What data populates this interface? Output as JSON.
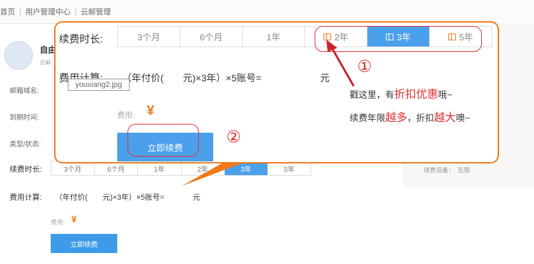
{
  "breadcrumb": [
    "首页",
    "用户管理中心",
    "云邮管理"
  ],
  "background": {
    "account_name": "自由",
    "account_sub": "企邮",
    "labels": [
      "邮箱域名:",
      "到期时间:",
      "类型/状态:"
    ],
    "renew_label": "续费时长:",
    "options": [
      "3个月",
      "6个月",
      "1年",
      "2年",
      "3年",
      "5年"
    ],
    "selected_option": "3年",
    "price_label": "费用计算:",
    "price_formula": "（年付价(　　元)×3年）×5账号=",
    "price_unit": "元",
    "fee_label": "费用:",
    "currency": "¥",
    "submit": "立即续费",
    "right_panel_text": "续费设备：　无限"
  },
  "callout": {
    "renew_label": "续费时长:",
    "options": [
      {
        "label": "3个月",
        "gift": false
      },
      {
        "label": "6个月",
        "gift": false
      },
      {
        "label": "1年",
        "gift": false
      },
      {
        "label": "2年",
        "gift": true
      },
      {
        "label": "3年",
        "gift": true
      },
      {
        "label": "5年",
        "gift": true
      }
    ],
    "selected_option": "3年",
    "price_label": "费用计算:",
    "price_formula": "（年付价(　　元)×3年）×5账号=",
    "price_unit": "元",
    "tooltip": "youxiang2.jpg",
    "fee_label": "费用:",
    "currency": "¥",
    "submit": "立即续费"
  },
  "annotations": {
    "marker_1": "①",
    "marker_2": "②",
    "promo_line1": {
      "pre": "戳这里，有",
      "highlight": "折扣优惠",
      "post": "哦~"
    },
    "promo_line2": {
      "pre": "续费年限",
      "hl1": "越多",
      "mid": "，折扣",
      "hl2": "越大",
      "post": "噢~"
    }
  },
  "colors": {
    "accent": "#4aa0ea",
    "orange": "#f07a1a",
    "red": "#e02f2f"
  }
}
